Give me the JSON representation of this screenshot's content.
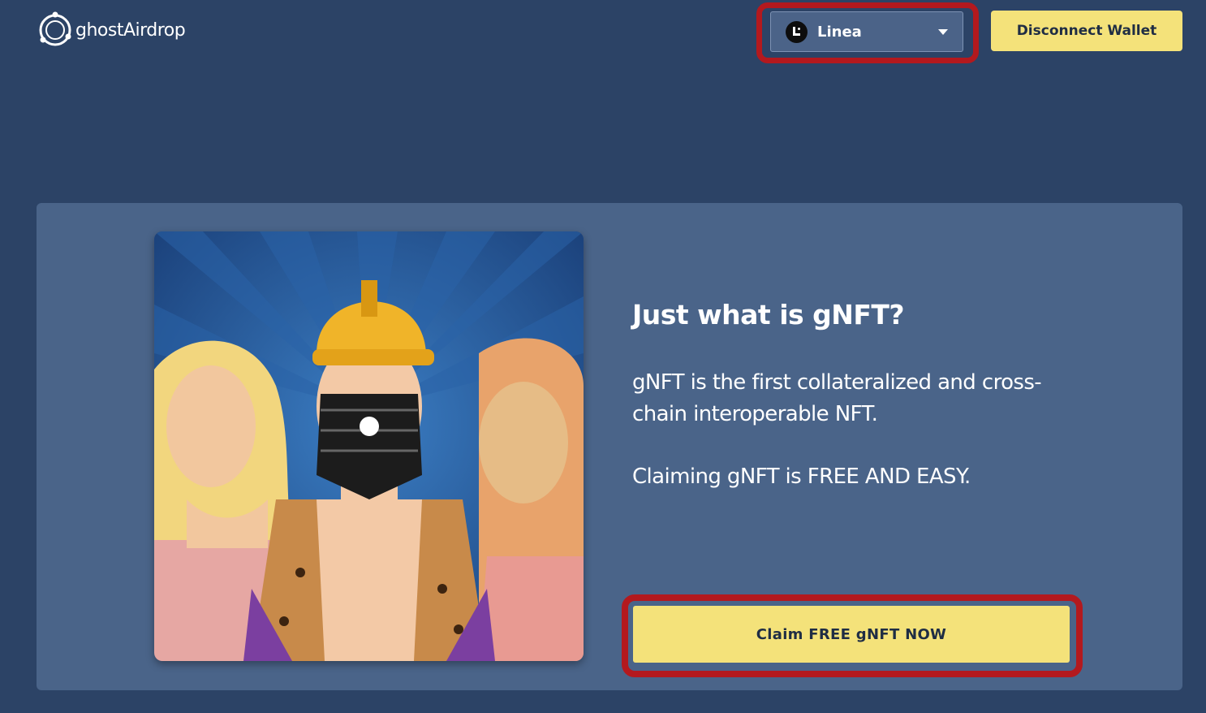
{
  "header": {
    "logo_text": "ghostAirdrop",
    "network": {
      "selected": "Linea",
      "icon": "linea-icon"
    },
    "disconnect_label": "Disconnect Wallet"
  },
  "main": {
    "headline": "Just what is gNFT?",
    "description": "gNFT is the first collateralized and cross-chain interoperable NFT.",
    "subtext": "Claiming gNFT is FREE AND EASY.",
    "claim_label": "Claim FREE gNFT NOW",
    "image": "gnft-artwork"
  },
  "colors": {
    "background": "#2c4366",
    "card": "#4a6489",
    "button": "#f4e27a",
    "highlight": "#b3191e"
  }
}
